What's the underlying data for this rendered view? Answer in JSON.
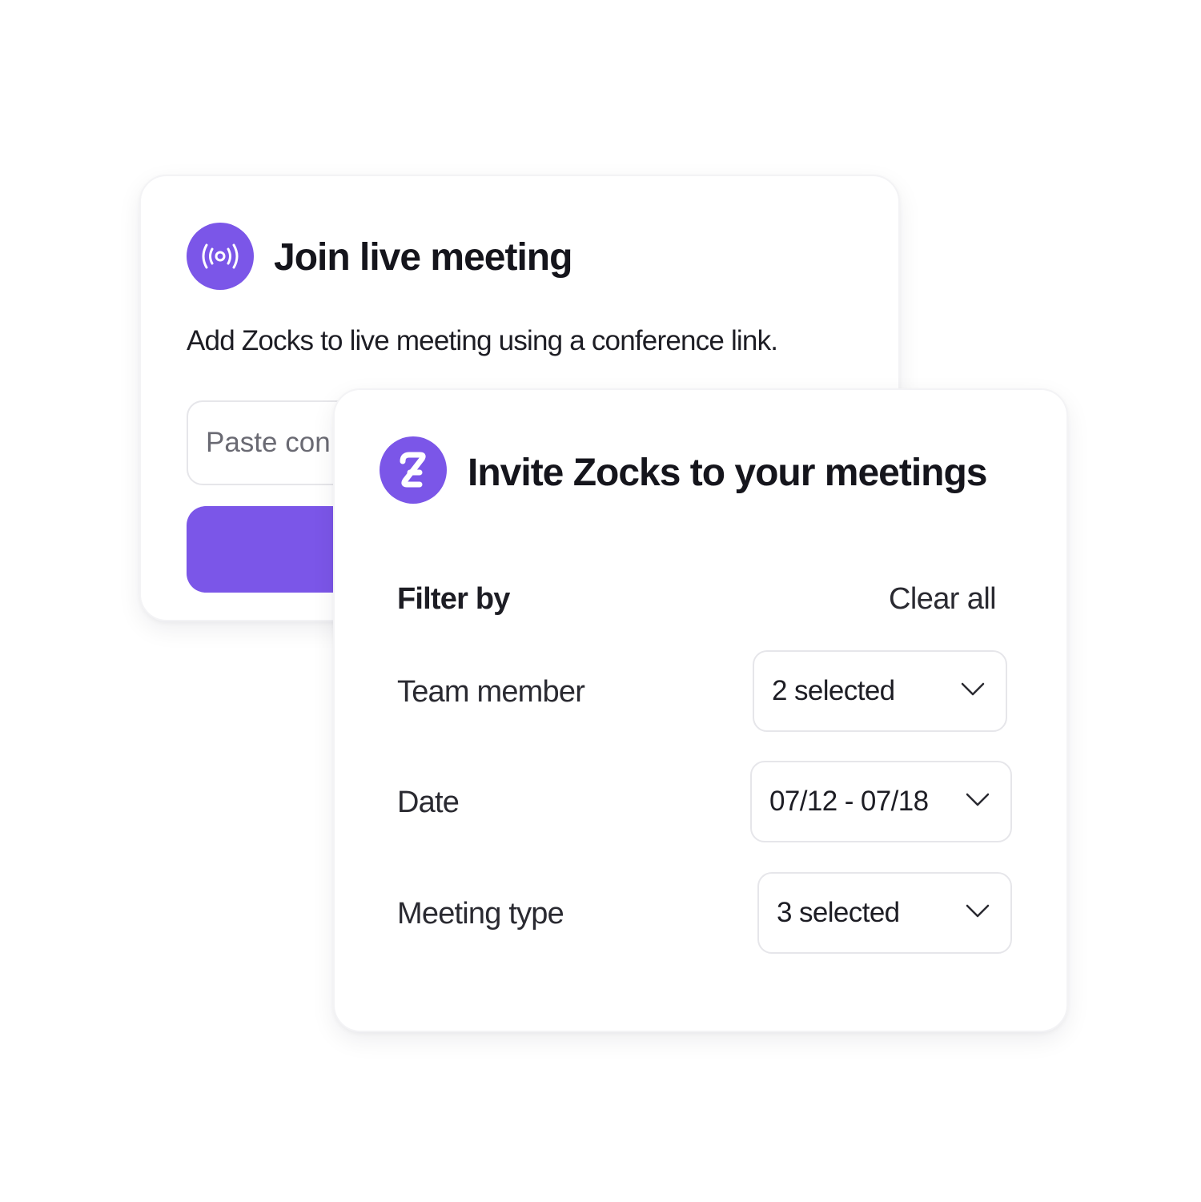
{
  "join_card": {
    "title": "Join live meeting",
    "subtitle": "Add Zocks to live meeting using a conference link.",
    "input_placeholder": "Paste con",
    "icon": "broadcast-icon"
  },
  "invite_card": {
    "title": "Invite Zocks to your meetings",
    "logo_icon": "zocks-logo-icon",
    "filter_heading": "Filter by",
    "clear_all": "Clear all",
    "filters": [
      {
        "label": "Team member",
        "value": "2 selected"
      },
      {
        "label": "Date",
        "value": "07/12 - 07/18"
      },
      {
        "label": "Meeting type",
        "value": "3 selected"
      }
    ]
  },
  "colors": {
    "accent": "#7b56e8",
    "text": "#15151c",
    "border": "#e6e6ea"
  }
}
